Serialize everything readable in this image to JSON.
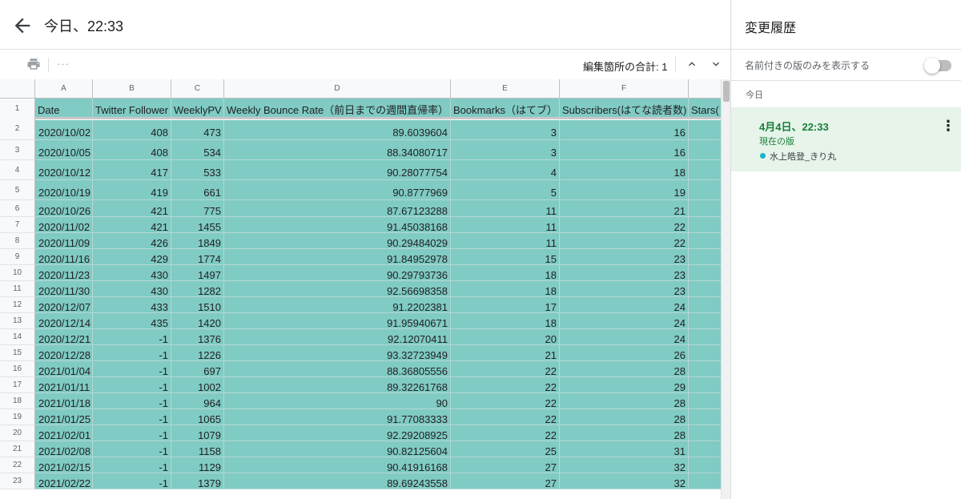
{
  "header": {
    "title": "今日、22:33"
  },
  "toolbar": {
    "more": "···",
    "edit_count": "編集箇所の合計: 1"
  },
  "columns": [
    "A",
    "B",
    "C",
    "D",
    "E",
    "F",
    ""
  ],
  "rows": [
    [
      "1",
      "Date",
      "Twitter Follower",
      "WeeklyPV",
      "Weekly Bounce Rate（前日までの週間直帰率）",
      "Bookmarks（はてブ）",
      "Subscribers(はてな読者数)",
      "Stars("
    ],
    [
      "2",
      "2020/10/02",
      "408",
      "473",
      "89.6039604",
      "3",
      "16",
      ""
    ],
    [
      "3",
      "2020/10/05",
      "408",
      "534",
      "88.34080717",
      "3",
      "16",
      ""
    ],
    [
      "4",
      "2020/10/12",
      "417",
      "533",
      "90.28077754",
      "4",
      "18",
      ""
    ],
    [
      "5",
      "2020/10/19",
      "419",
      "661",
      "90.8777969",
      "5",
      "19",
      ""
    ],
    [
      "6",
      "2020/10/26",
      "421",
      "775",
      "87.67123288",
      "11",
      "21",
      ""
    ],
    [
      "7",
      "2020/11/02",
      "421",
      "1455",
      "91.45038168",
      "11",
      "22",
      ""
    ],
    [
      "8",
      "2020/11/09",
      "426",
      "1849",
      "90.29484029",
      "11",
      "22",
      ""
    ],
    [
      "9",
      "2020/11/16",
      "429",
      "1774",
      "91.84952978",
      "15",
      "23",
      ""
    ],
    [
      "10",
      "2020/11/23",
      "430",
      "1497",
      "90.29793736",
      "18",
      "23",
      ""
    ],
    [
      "11",
      "2020/11/30",
      "430",
      "1282",
      "92.56698358",
      "18",
      "23",
      ""
    ],
    [
      "12",
      "2020/12/07",
      "433",
      "1510",
      "91.2202381",
      "17",
      "24",
      ""
    ],
    [
      "13",
      "2020/12/14",
      "435",
      "1420",
      "91.95940671",
      "18",
      "24",
      ""
    ],
    [
      "14",
      "2020/12/21",
      "-1",
      "1376",
      "92.12070411",
      "20",
      "24",
      ""
    ],
    [
      "15",
      "2020/12/28",
      "-1",
      "1226",
      "93.32723949",
      "21",
      "26",
      ""
    ],
    [
      "16",
      "2021/01/04",
      "-1",
      "697",
      "88.36805556",
      "22",
      "28",
      ""
    ],
    [
      "17",
      "2021/01/11",
      "-1",
      "1002",
      "89.32261768",
      "22",
      "29",
      ""
    ],
    [
      "18",
      "2021/01/18",
      "-1",
      "964",
      "90",
      "22",
      "28",
      ""
    ],
    [
      "19",
      "2021/01/25",
      "-1",
      "1065",
      "91.77083333",
      "22",
      "28",
      ""
    ],
    [
      "20",
      "2021/02/01",
      "-1",
      "1079",
      "92.29208925",
      "22",
      "28",
      ""
    ],
    [
      "21",
      "2021/02/08",
      "-1",
      "1158",
      "90.82125604",
      "25",
      "31",
      ""
    ],
    [
      "22",
      "2021/02/15",
      "-1",
      "1129",
      "90.41916168",
      "27",
      "32",
      ""
    ],
    [
      "23",
      "2021/02/22",
      "-1",
      "1379",
      "89.69243558",
      "27",
      "32",
      ""
    ]
  ],
  "panel": {
    "title": "変更履歴",
    "named_only": "名前付きの版のみを表示する",
    "today": "今日",
    "version": {
      "timestamp": "4月4日、22:33",
      "current": "現在の版",
      "user": "水上皓登_きり丸"
    }
  }
}
